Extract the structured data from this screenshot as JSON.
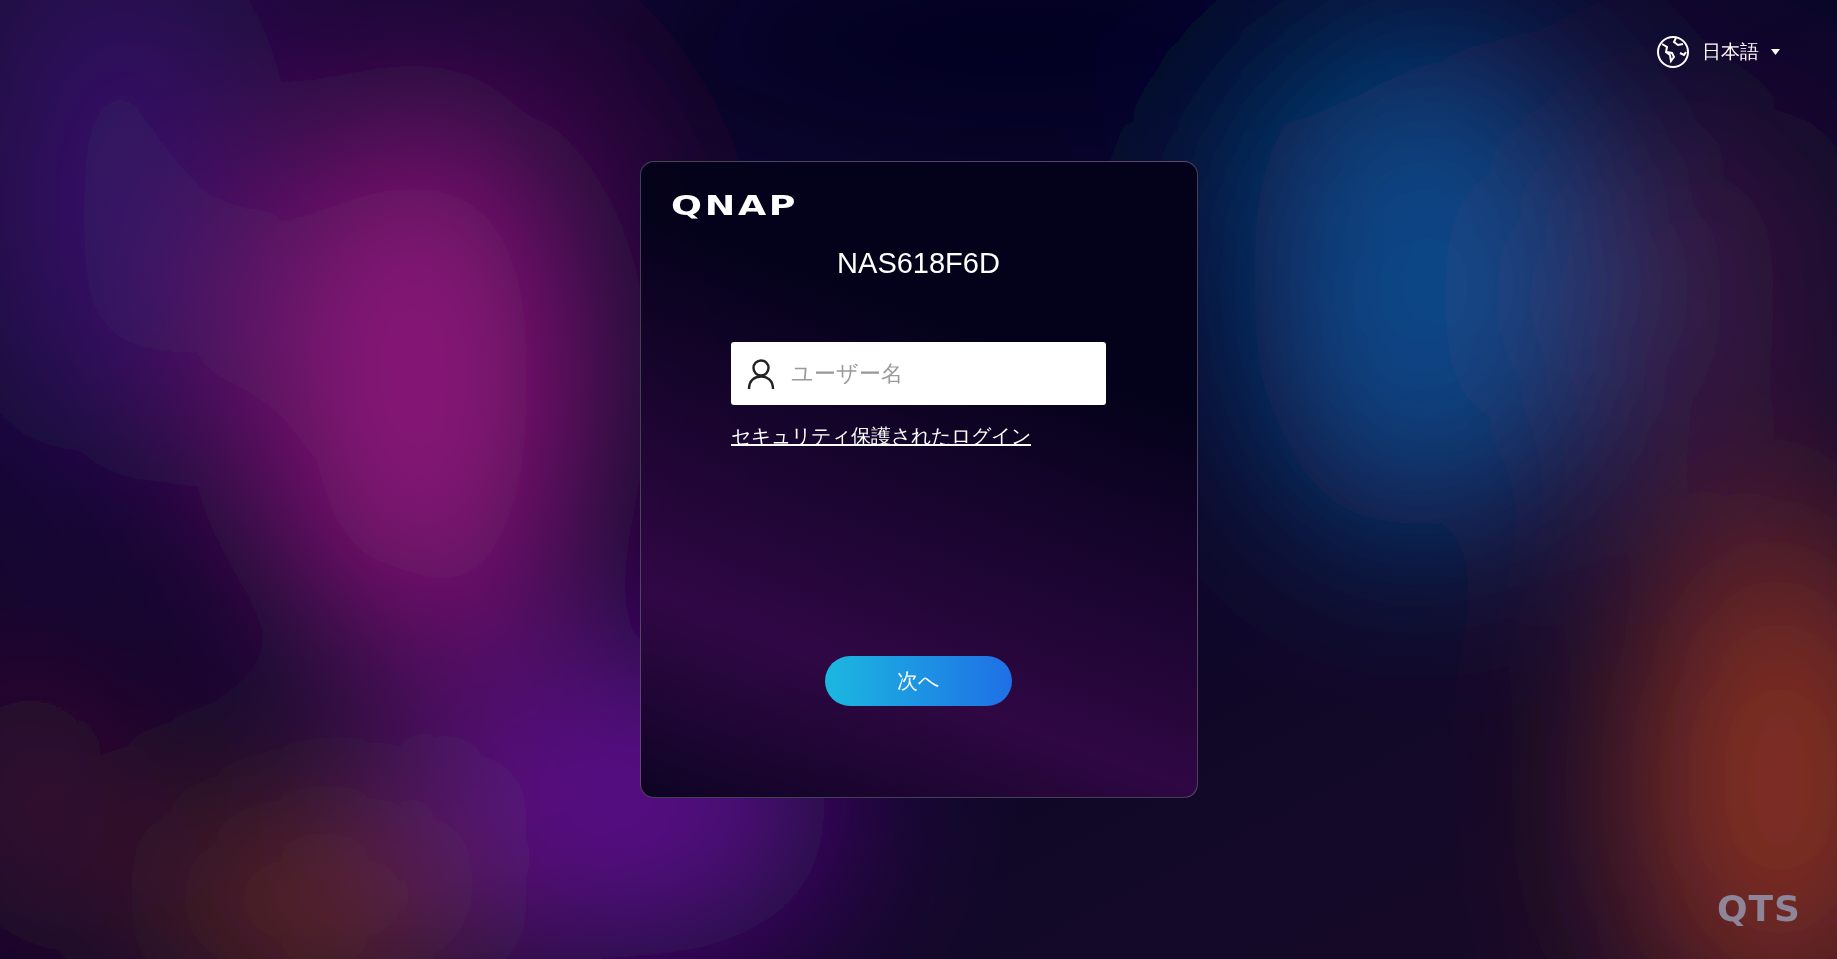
{
  "language_selector": {
    "label": "日本語"
  },
  "login_card": {
    "logo": "QNAP",
    "hostname": "NAS618F6D",
    "username_field": {
      "placeholder": "ユーザー名"
    },
    "secure_login_link": "セキュリティ保護されたログイン",
    "next_button": "次へ"
  },
  "footer_logo": "QTS"
}
